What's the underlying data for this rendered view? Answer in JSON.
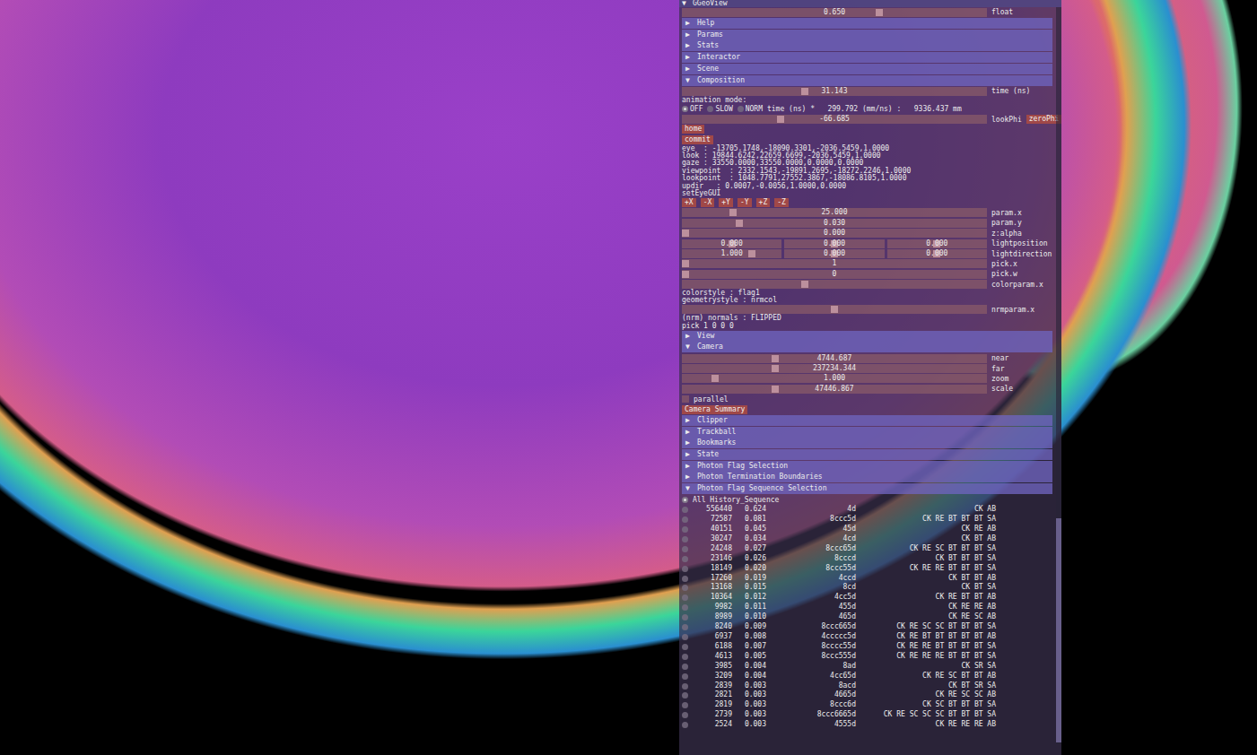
{
  "window": {
    "title": "GGeoView",
    "arrow": "▼"
  },
  "widgets": [
    {
      "kind": "slider",
      "value": "0.650",
      "label": "float",
      "level": 0.65
    },
    {
      "kind": "header",
      "arrow": "▶",
      "label": "Help"
    },
    {
      "kind": "header",
      "arrow": "▶",
      "label": "Params"
    },
    {
      "kind": "header",
      "arrow": "▶",
      "label": "Stats"
    },
    {
      "kind": "header",
      "arrow": "▶",
      "label": "Interactor"
    },
    {
      "kind": "header",
      "arrow": "▶",
      "label": "Scene"
    },
    {
      "kind": "header",
      "arrow": "▼",
      "label": "Composition"
    },
    {
      "kind": "slider",
      "value": "31.143",
      "label": "time (ns)",
      "level": 0.4
    },
    {
      "kind": "text",
      "text": "animation mode:"
    },
    {
      "kind": "radios",
      "options": [
        {
          "label": "OFF",
          "selected": true
        },
        {
          "label": "SLOW",
          "selected": false
        },
        {
          "label": "NORM",
          "selected": false
        }
      ],
      "text": "time (ns) *   299.792 (mm/ns) :   9336.437 mm"
    },
    {
      "kind": "slider",
      "value": "-66.685",
      "label": "lookPhi",
      "level": 0.32,
      "button": "zeroPhi"
    },
    {
      "kind": "button",
      "label": "home"
    },
    {
      "kind": "button",
      "label": "commit"
    },
    {
      "kind": "text",
      "text": "eye  : -13705.1748,-18090.3301,-2036.5459,1.0000"
    },
    {
      "kind": "text",
      "text": "look : 19844.6242,22659.6699,-2036.5459,1.0000"
    },
    {
      "kind": "text",
      "text": "gaze : 33550.0000,33550.0000,0.0000,0.0000"
    },
    {
      "kind": "text",
      "text": "viewpoint  : 2332.1543,-19891.2695,-18272.2246,1.0000"
    },
    {
      "kind": "text",
      "text": "lookpoint  : 1048.7791,27552.3867,-18086.8105,1.0000"
    },
    {
      "kind": "text",
      "text": "updir   : 0.0007,-0.0056,1.0000,0.0000"
    },
    {
      "kind": "text",
      "text": "setEyeGUI"
    },
    {
      "kind": "buttons",
      "labels": [
        "+X",
        "-X",
        "+Y",
        "-Y",
        "+Z",
        "-Z"
      ]
    },
    {
      "kind": "slider",
      "value": "25.000",
      "label": "param.x",
      "level": 0.16
    },
    {
      "kind": "slider",
      "value": "0.030",
      "label": "param.y",
      "level": 0.18
    },
    {
      "kind": "slider",
      "value": "0.000",
      "label": "z:alpha",
      "level": 0.0
    },
    {
      "kind": "slider3",
      "label": "lightposition",
      "parts": [
        {
          "value": "0.000",
          "level": 0.5
        },
        {
          "value": "0.000",
          "level": 0.5
        },
        {
          "value": "0.000",
          "level": 0.5
        }
      ]
    },
    {
      "kind": "slider3",
      "label": "lightdirection",
      "parts": [
        {
          "value": "1.000",
          "level": 0.72
        },
        {
          "value": "0.000",
          "level": 0.5
        },
        {
          "value": "0.000",
          "level": 0.5
        }
      ]
    },
    {
      "kind": "slider",
      "value": "1",
      "label": "pick.x",
      "level": 0.0
    },
    {
      "kind": "slider",
      "value": "0",
      "label": "pick.w",
      "level": 0.0
    },
    {
      "kind": "slider",
      "label": "colorparam.x",
      "level": 0.4
    },
    {
      "kind": "text",
      "text": "colorstyle : flag1"
    },
    {
      "kind": "text",
      "text": "geometrystyle : nrmcol"
    },
    {
      "kind": "slider",
      "label": "nrmparam.x",
      "level": 0.5
    },
    {
      "kind": "text",
      "text": "(nrm) normals : FLIPPED"
    },
    {
      "kind": "text",
      "text": "pick 1 0 0 0"
    },
    {
      "kind": "header",
      "arrow": "▶",
      "label": "View"
    },
    {
      "kind": "header",
      "arrow": "▼",
      "label": "Camera"
    },
    {
      "kind": "slider",
      "value": "4744.687",
      "label": "near",
      "level": 0.3
    },
    {
      "kind": "slider",
      "value": "237234.344",
      "label": "far",
      "level": 0.3
    },
    {
      "kind": "slider",
      "value": "1.000",
      "label": "zoom",
      "level": 0.1
    },
    {
      "kind": "slider",
      "value": "47446.867",
      "label": "scale",
      "level": 0.3
    },
    {
      "kind": "checkbox",
      "label": "parallel",
      "checked": false
    },
    {
      "kind": "button",
      "label": "Camera Summary"
    },
    {
      "kind": "header",
      "arrow": "▶",
      "label": "Clipper"
    },
    {
      "kind": "header",
      "arrow": "▶",
      "label": "Trackball"
    },
    {
      "kind": "header",
      "arrow": "▶",
      "label": "Bookmarks"
    },
    {
      "kind": "header",
      "arrow": "▶",
      "label": "State"
    },
    {
      "kind": "header",
      "arrow": "▶",
      "label": "Photon Flag Selection"
    },
    {
      "kind": "header",
      "arrow": "▶",
      "label": "Photon Termination Boundaries"
    },
    {
      "kind": "header",
      "arrow": "▼",
      "label": "Photon Flag Sequence Selection"
    },
    {
      "kind": "radio",
      "label": "All History_Sequence",
      "selected": true
    },
    {
      "kind": "seq",
      "count": "556440",
      "frac": "0.624",
      "hex": "4d",
      "seq": "CK AB",
      "selected": false
    },
    {
      "kind": "seq",
      "count": "72587",
      "frac": "0.081",
      "hex": "8ccc5d",
      "seq": "CK RE BT BT BT SA",
      "selected": false
    },
    {
      "kind": "seq",
      "count": "40151",
      "frac": "0.045",
      "hex": "45d",
      "seq": "CK RE AB",
      "selected": false
    },
    {
      "kind": "seq",
      "count": "30247",
      "frac": "0.034",
      "hex": "4cd",
      "seq": "CK BT AB",
      "selected": false
    },
    {
      "kind": "seq",
      "count": "24248",
      "frac": "0.027",
      "hex": "8ccc65d",
      "seq": "CK RE SC BT BT BT SA",
      "selected": false
    },
    {
      "kind": "seq",
      "count": "23146",
      "frac": "0.026",
      "hex": "8cccd",
      "seq": "CK BT BT BT SA",
      "selected": false
    },
    {
      "kind": "seq",
      "count": "18149",
      "frac": "0.020",
      "hex": "8ccc55d",
      "seq": "CK RE RE BT BT BT SA",
      "selected": false
    },
    {
      "kind": "seq",
      "count": "17260",
      "frac": "0.019",
      "hex": "4ccd",
      "seq": "CK BT BT AB",
      "selected": false
    },
    {
      "kind": "seq",
      "count": "13168",
      "frac": "0.015",
      "hex": "8cd",
      "seq": "CK BT SA",
      "selected": false
    },
    {
      "kind": "seq",
      "count": "10364",
      "frac": "0.012",
      "hex": "4cc5d",
      "seq": "CK RE BT BT AB",
      "selected": false
    },
    {
      "kind": "seq",
      "count": "9982",
      "frac": "0.011",
      "hex": "455d",
      "seq": "CK RE RE AB",
      "selected": false
    },
    {
      "kind": "seq",
      "count": "8989",
      "frac": "0.010",
      "hex": "465d",
      "seq": "CK RE SC AB",
      "selected": false
    },
    {
      "kind": "seq",
      "count": "8240",
      "frac": "0.009",
      "hex": "8ccc665d",
      "seq": "CK RE SC SC BT BT BT SA",
      "selected": false
    },
    {
      "kind": "seq",
      "count": "6937",
      "frac": "0.008",
      "hex": "4ccccc5d",
      "seq": "CK RE BT BT BT BT BT AB",
      "selected": false
    },
    {
      "kind": "seq",
      "count": "6188",
      "frac": "0.007",
      "hex": "8cccc55d",
      "seq": "CK RE RE BT BT BT BT SA",
      "selected": false
    },
    {
      "kind": "seq",
      "count": "4613",
      "frac": "0.005",
      "hex": "8ccc555d",
      "seq": "CK RE RE RE BT BT BT SA",
      "selected": false
    },
    {
      "kind": "seq",
      "count": "3985",
      "frac": "0.004",
      "hex": "8ad",
      "seq": "CK SR SA",
      "selected": false
    },
    {
      "kind": "seq",
      "count": "3209",
      "frac": "0.004",
      "hex": "4cc65d",
      "seq": "CK RE SC BT BT AB",
      "selected": false
    },
    {
      "kind": "seq",
      "count": "2839",
      "frac": "0.003",
      "hex": "8acd",
      "seq": "CK BT SR SA",
      "selected": false
    },
    {
      "kind": "seq",
      "count": "2821",
      "frac": "0.003",
      "hex": "4665d",
      "seq": "CK RE SC SC AB",
      "selected": false
    },
    {
      "kind": "seq",
      "count": "2819",
      "frac": "0.003",
      "hex": "8ccc6d",
      "seq": "CK SC BT BT BT SA",
      "selected": false
    },
    {
      "kind": "seq",
      "count": "2739",
      "frac": "0.003",
      "hex": "8ccc6665d",
      "seq": "CK RE SC SC SC BT BT BT SA",
      "selected": false
    },
    {
      "kind": "seq",
      "count": "2524",
      "frac": "0.003",
      "hex": "4555d",
      "seq": "CK RE RE RE AB",
      "selected": false
    }
  ]
}
